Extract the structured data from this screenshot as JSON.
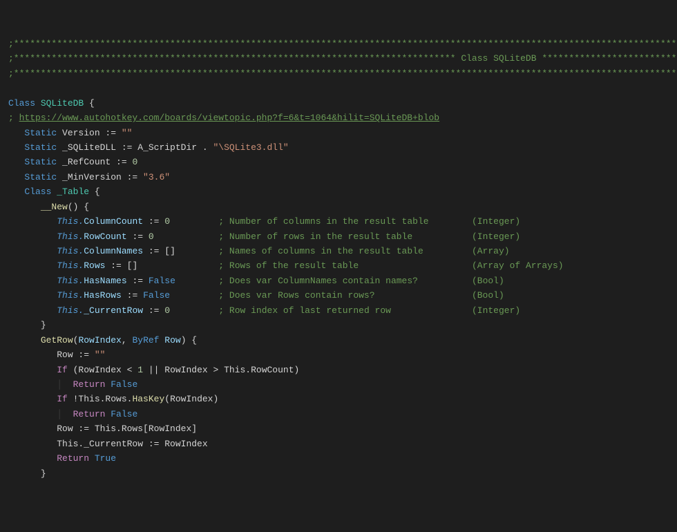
{
  "lines": {
    "sep": ";*****************************************************************************************************************************",
    "title_pre": ";********************************************************************************** ",
    "title": "Class SQLiteDB",
    "title_post": " *************************",
    "class_decl": {
      "kw": "Class",
      "name": "SQLiteDB",
      "brace": " {"
    },
    "link_prefix": "; ",
    "link": "https://www.autohotkey.com/boards/viewtopic.php?f=6&t=1064&hilit=SQLiteDB+blob",
    "s1": {
      "kw": "Static",
      "name": " Version := ",
      "val": "\"\""
    },
    "s2": {
      "kw": "Static",
      "name": " _SQLiteDLL := A_ScriptDir . ",
      "val": "\"\\SQLite3.dll\""
    },
    "s3": {
      "kw": "Static",
      "name": " _RefCount := ",
      "val": "0"
    },
    "s4": {
      "kw": "Static",
      "name": " _MinVersion := ",
      "val": "\"3.6\""
    },
    "subclass": {
      "kw": "Class",
      "name": "_Table",
      "brace": " {"
    },
    "new": {
      "name": "__New",
      "post": "() {"
    },
    "b1": {
      "pre": "This.",
      "prop": "ColumnCount",
      "mid": " := ",
      "val": "0",
      "pad": "         ",
      "comment": "; Number of columns in the result table        (Integer)"
    },
    "b2": {
      "pre": "This.",
      "prop": "RowCount",
      "mid": " := ",
      "val": "0",
      "pad": "            ",
      "comment": "; Number of rows in the result table           (Integer)"
    },
    "b3": {
      "pre": "This.",
      "prop": "ColumnNames",
      "mid": " := []",
      "pad": "        ",
      "comment": "; Names of columns in the result table         (Array)"
    },
    "b4": {
      "pre": "This.",
      "prop": "Rows",
      "mid": " := []",
      "pad": "               ",
      "comment": "; Rows of the result table                     (Array of Arrays)"
    },
    "b5": {
      "pre": "This.",
      "prop": "HasNames",
      "mid": " := ",
      "val": "False",
      "pad": "        ",
      "comment": "; Does var ColumnNames contain names?          (Bool)"
    },
    "b6": {
      "pre": "This.",
      "prop": "HasRows",
      "mid": " := ",
      "val": "False",
      "pad": "         ",
      "comment": "; Does var Rows contain rows?                  (Bool)"
    },
    "b7": {
      "pre": "This.",
      "prop": "_CurrentRow",
      "mid": " := ",
      "val": "0",
      "pad": "         ",
      "comment": "; Row index of last returned row               (Integer)"
    },
    "close_new": "}",
    "getrow": {
      "name": "GetRow",
      "open": "(",
      "p1": "RowIndex",
      "comma": ", ",
      "byref": "ByRef",
      "p2": " Row",
      "close": ") {"
    },
    "gr1": {
      "text": "Row := ",
      "val": "\"\""
    },
    "gr2": {
      "kw": "If",
      "text": " (RowIndex < ",
      "num": "1",
      "rest": " || RowIndex > This.RowCount)"
    },
    "gr3": {
      "kw": "Return",
      "val": " False"
    },
    "gr4": {
      "kw": "If",
      "text": " !This.Rows.",
      "fn": "HasKey",
      "rest": "(RowIndex)"
    },
    "gr5": {
      "kw": "Return",
      "val": " False"
    },
    "gr6": "Row := This.Rows[RowIndex]",
    "gr7": "This._CurrentRow := RowIndex",
    "gr8": {
      "kw": "Return",
      "val": " True"
    },
    "close_getrow": "}"
  }
}
